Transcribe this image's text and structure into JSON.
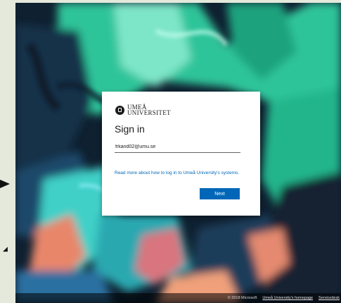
{
  "logo": {
    "line1": "UMEÅ",
    "line2": "UNIVERSITET"
  },
  "signin": {
    "title": "Sign in",
    "email_value": "frkand02@umu.se",
    "help_link": "Read more about how to log in to Umeå University's systems.",
    "next_label": "Next"
  },
  "footer": {
    "copyright": "© 2018 Microsoft",
    "homepage_link": "Umeå University's homepage",
    "servicedesk_link": "Servicedesk"
  },
  "colors": {
    "accent": "#0067b8",
    "card": "#ffffff",
    "backdrop": "#e4e9dc"
  },
  "icons": {
    "logo": "university-seal-icon",
    "pointer": "arrow-right-icon"
  }
}
